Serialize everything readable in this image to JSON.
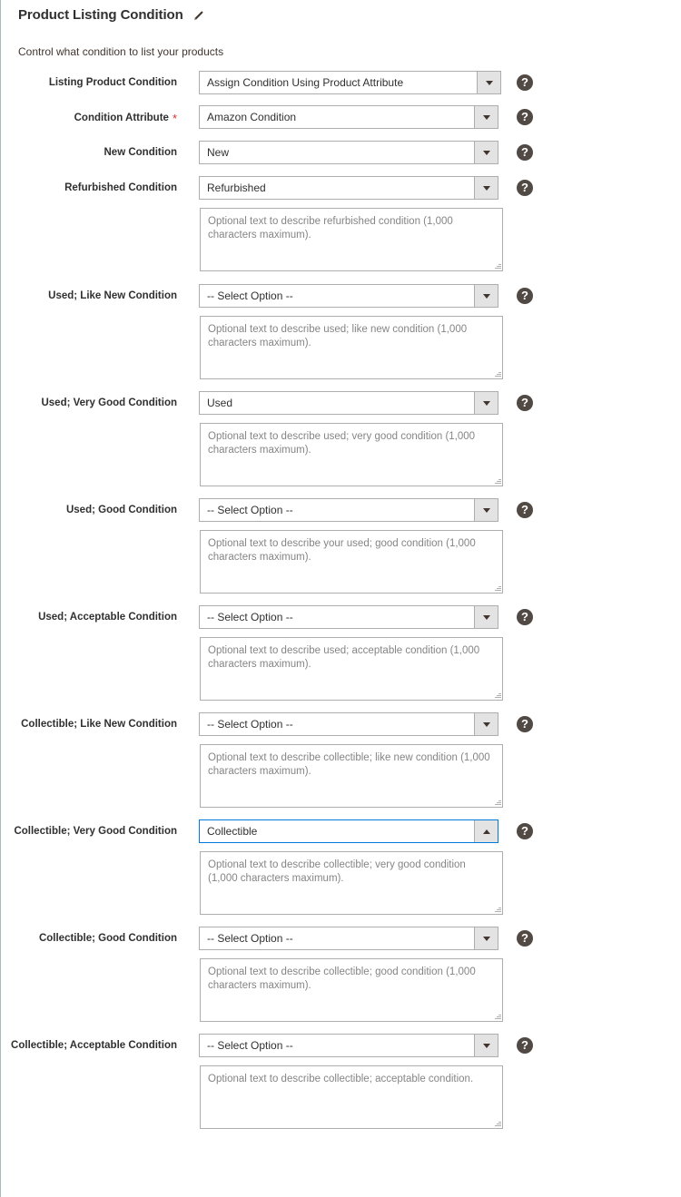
{
  "section": {
    "title": "Product Listing Condition",
    "edit_icon": "pencil-icon",
    "subtitle": "Control what condition to list your products",
    "required_marker": "*",
    "help_glyph": "?"
  },
  "colors": {
    "accent_focus": "#007bdb",
    "required_red": "#e02b27",
    "help_icon_bg": "#514943",
    "text": "#303030",
    "placeholder": "#858585",
    "border": "#adadad",
    "select_button_bg": "#e3e3e3"
  },
  "select_placeholder": "-- Select Option --",
  "rows": [
    {
      "label": "Listing Product Condition",
      "required": false,
      "select_value": "Assign Condition Using Product Attribute",
      "select_state": "closed",
      "has_textarea": false,
      "textarea_placeholder": ""
    },
    {
      "label": "Condition Attribute",
      "required": true,
      "select_value": "Amazon Condition",
      "select_state": "closed",
      "has_textarea": false,
      "textarea_placeholder": ""
    },
    {
      "label": "New Condition",
      "required": false,
      "select_value": "New",
      "select_state": "closed",
      "has_textarea": false,
      "textarea_placeholder": ""
    },
    {
      "label": "Refurbished Condition",
      "required": false,
      "select_value": "Refurbished",
      "select_state": "closed",
      "has_textarea": true,
      "textarea_placeholder": "Optional text to describe refurbished condition (1,000 characters maximum)."
    },
    {
      "label": "Used; Like New Condition",
      "required": false,
      "select_value": "-- Select Option --",
      "select_state": "closed",
      "has_textarea": true,
      "textarea_placeholder": "Optional text to describe used; like new condition (1,000 characters maximum)."
    },
    {
      "label": "Used; Very Good Condition",
      "required": false,
      "select_value": "Used",
      "select_state": "closed",
      "has_textarea": true,
      "textarea_placeholder": "Optional text to describe used; very good condition (1,000 characters maximum)."
    },
    {
      "label": "Used; Good Condition",
      "required": false,
      "select_value": "-- Select Option --",
      "select_state": "closed",
      "has_textarea": true,
      "textarea_placeholder": "Optional text to describe your used; good condition (1,000 characters maximum)."
    },
    {
      "label": "Used; Acceptable Condition",
      "required": false,
      "select_value": "-- Select Option --",
      "select_state": "closed",
      "has_textarea": true,
      "textarea_placeholder": "Optional text to describe used; acceptable condition (1,000 characters maximum)."
    },
    {
      "label": "Collectible; Like New Condition",
      "required": false,
      "select_value": "-- Select Option --",
      "select_state": "closed",
      "has_textarea": true,
      "textarea_placeholder": "Optional text to describe collectible; like new condition (1,000 characters maximum)."
    },
    {
      "label": "Collectible; Very Good Condition",
      "required": false,
      "select_value": "Collectible",
      "select_state": "open",
      "has_textarea": true,
      "textarea_placeholder": "Optional text to describe collectible; very good condition (1,000 characters maximum)."
    },
    {
      "label": "Collectible; Good Condition",
      "required": false,
      "select_value": "-- Select Option --",
      "select_state": "closed",
      "has_textarea": true,
      "textarea_placeholder": "Optional text to describe collectible; good condition (1,000 characters maximum)."
    },
    {
      "label": "Collectible; Acceptable Condition",
      "required": false,
      "select_value": "-- Select Option --",
      "select_state": "closed",
      "has_textarea": true,
      "textarea_placeholder": "Optional text to describe collectible; acceptable condition."
    }
  ]
}
